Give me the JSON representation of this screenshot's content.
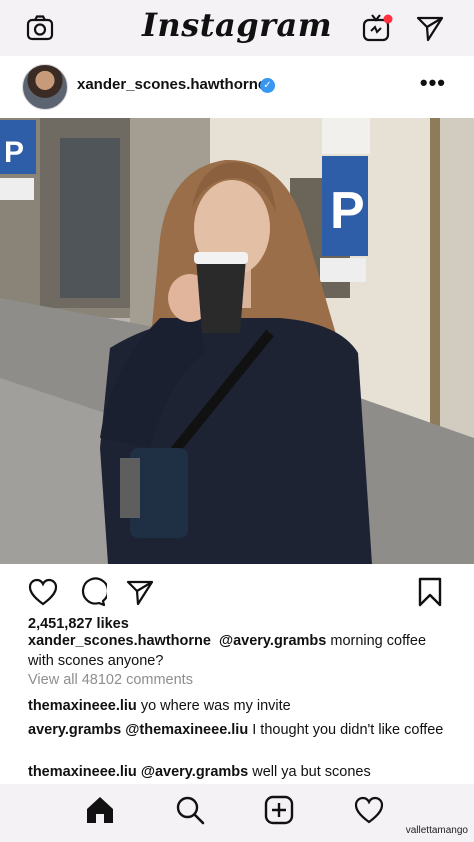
{
  "app": {
    "logo_text": "Instagram"
  },
  "post": {
    "username": "xander_scones.hawthorne",
    "verified": true,
    "likes": "2,451,827 likes",
    "caption": {
      "username": "xander_scones.hawthorne",
      "mention": "@avery.grambs",
      "text_line1": "morning  coffee",
      "text_line2": "with scones anyone?"
    },
    "view_all_comments": "View all 48102 comments",
    "comments": [
      {
        "user": "themaxineee.liu",
        "text": "yo where was my invite"
      },
      {
        "user": "avery.grambs",
        "mention": "@themaxineee.liu",
        "text": "I thought you didn't like coffee"
      },
      {
        "user": "themaxineee.liu",
        "mention": "@avery.grambs",
        "text": "well ya but scones"
      }
    ]
  },
  "watermark": "vallettamango",
  "colors": {
    "accent_red": "#ff3040",
    "verified_blue": "#3897f0",
    "text_muted": "#8e8e8e"
  },
  "icons": [
    "camera-icon",
    "igtv-icon",
    "direct-send-icon",
    "more-icon",
    "heart-icon",
    "comment-icon",
    "share-icon",
    "bookmark-icon",
    "home-icon",
    "search-icon",
    "add-post-icon",
    "activity-heart-icon"
  ]
}
